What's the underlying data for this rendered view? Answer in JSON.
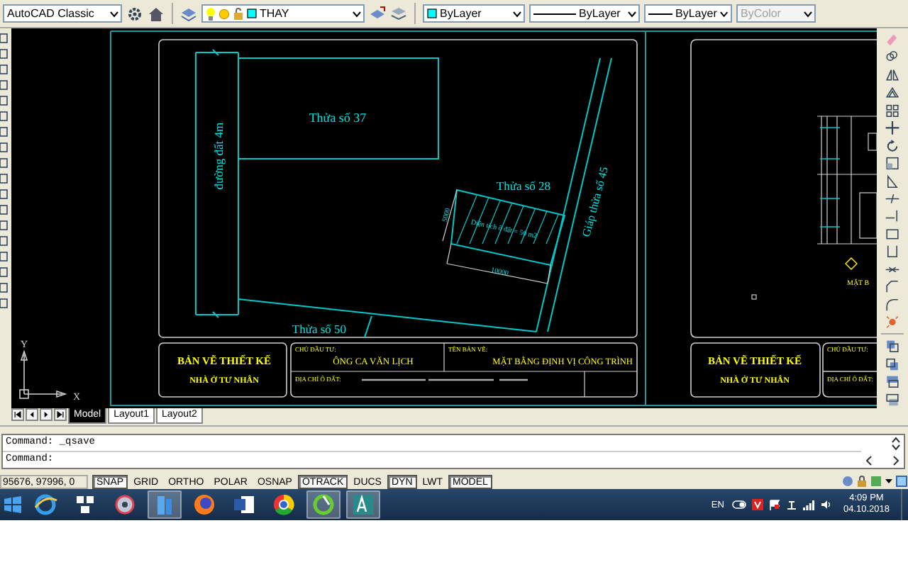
{
  "toolbar": {
    "workspace": "AutoCAD Classic",
    "layer": "THAY",
    "color_setting": "ByLayer",
    "linetype": "ByLayer",
    "lineweight": "ByLayer",
    "plot_style": {
      "label": "ByColor",
      "disabled": true
    }
  },
  "drawing": {
    "site": {
      "lot_37": "Thửa số 37",
      "road": "đường đất 4m",
      "lot_28": "Thửa số 28",
      "adjacent_lot": "Giáp thửa số 45",
      "lot_area": "Diện tích ô đất = 50 m2",
      "width_dimension": "5000",
      "length_dimension": "10000",
      "lot_50": "Thửa số 50"
    },
    "title_block": {
      "title": "BẢN VẼ THIẾT KẾ",
      "subtitle": "NHÀ Ở TƯ NHÂN",
      "owner_label": "CHỦ ĐẦU TƯ:",
      "owner": "ÔNG CA VĂN LỊCH",
      "sheet_label": "TÊN BẢN VẼ:",
      "sheet_name": "MẶT BẰNG ĐỊNH VỊ CÔNG TRÌNH",
      "address_label": "ĐỊA CHỈ Ô ĐẤT:"
    },
    "second_sheet": {
      "title": "BẢN VẼ THIẾT KẾ",
      "subtitle": "NHÀ Ở TƯ NHÂN",
      "owner_label": "CHỦ ĐẦU TƯ:",
      "address_label": "ĐỊA CHỈ Ô ĐẤT:",
      "view_label": "MẶT B"
    },
    "ucs": {
      "y": "Y",
      "x": "X"
    }
  },
  "layout_tabs": [
    {
      "label": "Model",
      "selected": true
    },
    {
      "label": "Layout1",
      "selected": false
    },
    {
      "label": "Layout2",
      "selected": false
    }
  ],
  "command_lines": [
    "Command: _qsave",
    "Command:"
  ],
  "status_bar": {
    "coordinates": "95676, 97996, 0",
    "toggles": [
      {
        "label": "SNAP",
        "on": true
      },
      {
        "label": "GRID",
        "on": false
      },
      {
        "label": "ORTHO",
        "on": false
      },
      {
        "label": "POLAR",
        "on": false
      },
      {
        "label": "OSNAP",
        "on": false
      },
      {
        "label": "OTRACK",
        "on": true
      },
      {
        "label": "DUCS",
        "on": false
      },
      {
        "label": "DYN",
        "on": true
      },
      {
        "label": "LWT",
        "on": false
      },
      {
        "label": "MODEL",
        "on": true
      }
    ]
  },
  "taskbar": {
    "apps": [
      {
        "kind": "e-browser",
        "active": false
      },
      {
        "kind": "keys",
        "active": false
      },
      {
        "kind": "disc",
        "active": false
      },
      {
        "kind": "folders",
        "active": true
      },
      {
        "kind": "fox-browser",
        "active": false
      },
      {
        "kind": "document",
        "active": false
      },
      {
        "kind": "ring-browser",
        "active": false
      },
      {
        "kind": "green-disc",
        "active": true
      },
      {
        "kind": "cad",
        "active": true
      }
    ],
    "language": "EN",
    "time": "4:09 PM",
    "date": "04.10.2018"
  }
}
